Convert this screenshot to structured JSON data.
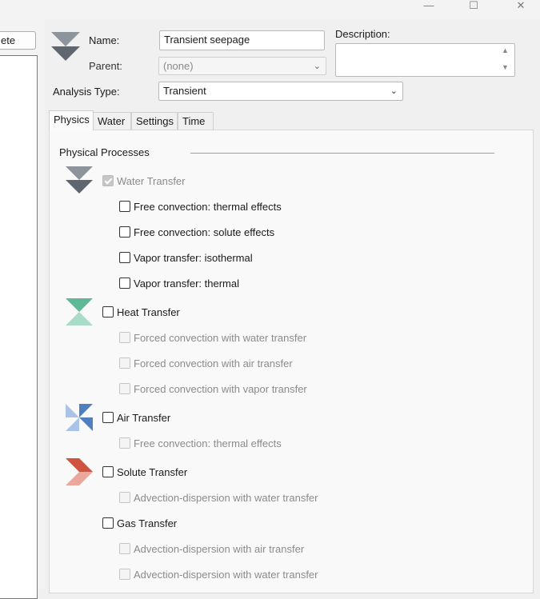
{
  "window": {
    "minimize_glyph": "—",
    "maximize_glyph": "☐",
    "close_glyph": "✕"
  },
  "left_pane": {
    "delete_button_label": "ete"
  },
  "header": {
    "name_label": "Name:",
    "name_value": "Transient seepage",
    "description_label": "Description:",
    "description_value": "",
    "parent_label": "Parent:",
    "parent_value": "(none)",
    "analysis_type_label": "Analysis Type:",
    "analysis_type_value": "Transient"
  },
  "tabs": [
    {
      "label": "Physics",
      "active": true
    },
    {
      "label": "Water",
      "active": false
    },
    {
      "label": "Settings",
      "active": false
    },
    {
      "label": "Time",
      "active": false
    }
  ],
  "physics": {
    "section_title": "Physical Processes",
    "processes": [
      {
        "label": "Water Transfer",
        "checked": true,
        "enabled": false,
        "icon": "water-transfer-icon",
        "options": [
          {
            "label": "Free convection: thermal effects",
            "checked": false,
            "enabled": true
          },
          {
            "label": "Free convection: solute effects",
            "checked": false,
            "enabled": true
          },
          {
            "label": "Vapor transfer: isothermal",
            "checked": false,
            "enabled": true
          },
          {
            "label": "Vapor transfer: thermal",
            "checked": false,
            "enabled": true
          }
        ]
      },
      {
        "label": "Heat Transfer",
        "checked": false,
        "enabled": true,
        "icon": "heat-transfer-icon",
        "options": [
          {
            "label": "Forced convection with water transfer",
            "checked": false,
            "enabled": false
          },
          {
            "label": "Forced convection with air transfer",
            "checked": false,
            "enabled": false
          },
          {
            "label": "Forced convection with vapor transfer",
            "checked": false,
            "enabled": false
          }
        ]
      },
      {
        "label": "Air Transfer",
        "checked": false,
        "enabled": true,
        "icon": "air-transfer-icon",
        "options": [
          {
            "label": "Free convection: thermal effects",
            "checked": false,
            "enabled": false
          }
        ]
      },
      {
        "label": "Solute Transfer",
        "checked": false,
        "enabled": true,
        "icon": "solute-transfer-icon",
        "options": [
          {
            "label": "Advection-dispersion with water transfer",
            "checked": false,
            "enabled": false
          }
        ]
      },
      {
        "label": "Gas Transfer",
        "checked": false,
        "enabled": true,
        "icon": "",
        "options": [
          {
            "label": "Advection-dispersion with air transfer",
            "checked": false,
            "enabled": false
          },
          {
            "label": "Advection-dispersion with water transfer",
            "checked": false,
            "enabled": false
          }
        ]
      }
    ]
  },
  "colors": {
    "water_icon": "#5f6670",
    "heat_icon": "#5fb896",
    "air_icon": "#4f7fbf",
    "solute_icon": "#d0533f"
  }
}
